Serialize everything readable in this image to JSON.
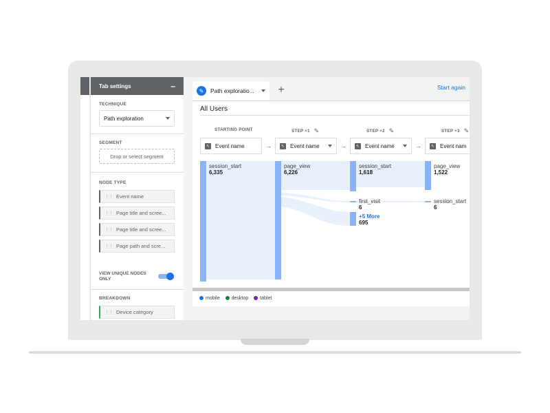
{
  "tab_settings": {
    "title": "Tab settings",
    "technique_label": "TECHNIQUE",
    "technique_value": "Path exploration",
    "segment_label": "SEGMENT",
    "segment_placeholder": "Drop or select segment",
    "node_type_label": "NODE TYPE",
    "node_types": [
      "Event name",
      "Page title and scree...",
      "Page title and scree...",
      "Page path and scre..."
    ],
    "view_unique_label_1": "VIEW UNIQUE NODES",
    "view_unique_label_2": "ONLY",
    "view_unique_on": true,
    "breakdown_label": "BREAKDOWN",
    "breakdown_value": "Device category"
  },
  "tabs": {
    "active_label": "Path exploratio...",
    "start_again": "Start again"
  },
  "segment_title": "All Users",
  "steps": [
    {
      "label": "STARTING POINT",
      "select": "Event name"
    },
    {
      "label": "STEP +1",
      "select": "Event name"
    },
    {
      "label": "STEP +2",
      "select": "Event name"
    },
    {
      "label": "STEP +3",
      "select": "Event nam"
    }
  ],
  "nodes": {
    "start": {
      "name": "session_start",
      "value": "6,335"
    },
    "step1": {
      "name": "page_view",
      "value": "6,226"
    },
    "step2_a": {
      "name": "session_start",
      "value": "1,618"
    },
    "step2_b": {
      "name": "first_visit",
      "value": "6"
    },
    "step2_more": {
      "name": "+5 More",
      "value": "695"
    },
    "step3_a": {
      "name": "page_view",
      "value": "1,522"
    },
    "step3_b": {
      "name": "session_start",
      "value": "6"
    }
  },
  "legend": [
    {
      "name": "mobile",
      "color": "#1a73e8"
    },
    {
      "name": "desktop",
      "color": "#188038"
    },
    {
      "name": "tablet",
      "color": "#7b1fa2"
    }
  ],
  "colors": {
    "node": "#8ab4f8",
    "flow": "#e8f0fe",
    "accent": "#1a73e8"
  }
}
